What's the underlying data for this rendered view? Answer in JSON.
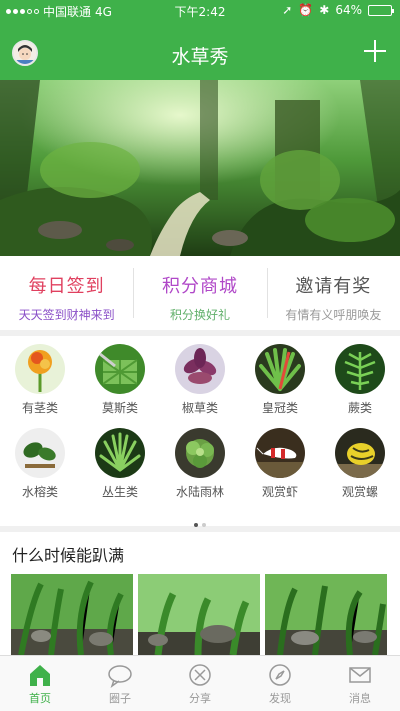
{
  "status_bar": {
    "carrier": "中国联通",
    "network": "4G",
    "time": "下午2:42",
    "battery": "64%",
    "battery_level": 0.64
  },
  "header": {
    "title": "水草秀"
  },
  "features": [
    {
      "title": "每日签到",
      "subtitle": "天天签到财神来到",
      "title_color": "#e0405f",
      "subtitle_color": "#8a4fc7"
    },
    {
      "title": "积分商城",
      "subtitle": "积分换好礼",
      "title_color": "#b048c8",
      "subtitle_color": "#62b06b"
    },
    {
      "title": "邀请有奖",
      "subtitle": "有情有义呼朋唤友",
      "title_color": "#555555",
      "subtitle_color": "#999999"
    }
  ],
  "categories": [
    {
      "label": "有茎类"
    },
    {
      "label": "莫斯类"
    },
    {
      "label": "椒草类"
    },
    {
      "label": "皇冠类"
    },
    {
      "label": "蕨类"
    },
    {
      "label": "水榕类"
    },
    {
      "label": "丛生类"
    },
    {
      "label": "水陆雨林"
    },
    {
      "label": "观赏虾"
    },
    {
      "label": "观赏螺"
    }
  ],
  "pager": {
    "current": 1,
    "total": 2
  },
  "section": {
    "title": "什么时候能趴满"
  },
  "tabs": [
    {
      "label": "首页",
      "active": true
    },
    {
      "label": "圈子",
      "active": false
    },
    {
      "label": "分享",
      "active": false
    },
    {
      "label": "发现",
      "active": false
    },
    {
      "label": "消息",
      "active": false
    }
  ],
  "colors": {
    "brand": "#3fb14a",
    "inactive": "#999999"
  }
}
